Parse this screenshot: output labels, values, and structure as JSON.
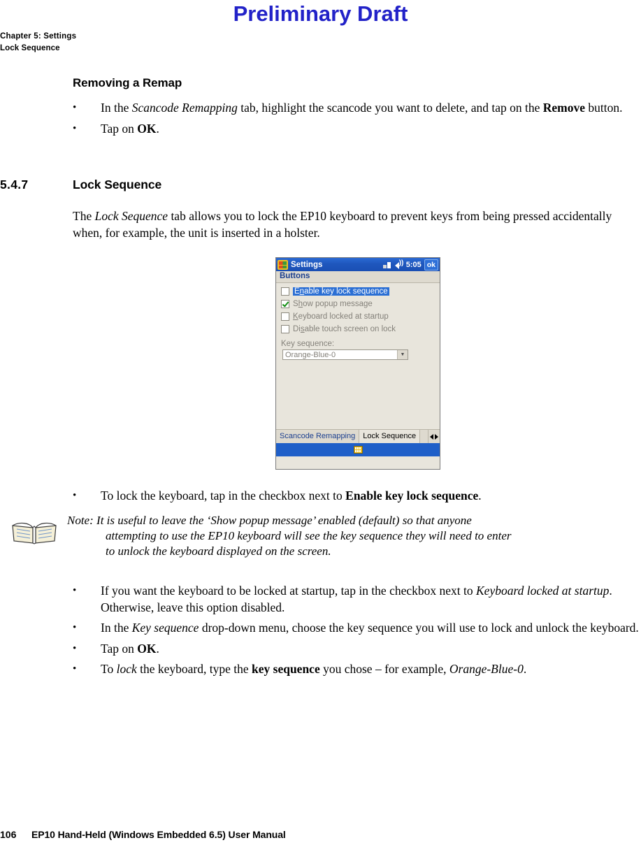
{
  "watermark": "Preliminary Draft",
  "header": {
    "line1": "Chapter 5: Settings",
    "line2": "Lock Sequence"
  },
  "subhead": "Removing a Remap",
  "bullets_top": [
    {
      "mark": "•",
      "parts": [
        {
          "t": "In the ",
          "s": "normal"
        },
        {
          "t": "Scancode Remapping",
          "s": "italic"
        },
        {
          "t": " tab, highlight the scancode you want to delete, and tap on the ",
          "s": "normal"
        },
        {
          "t": "Remove",
          "s": "bold"
        },
        {
          "t": " button.",
          "s": "normal"
        }
      ]
    },
    {
      "mark": "•",
      "parts": [
        {
          "t": "Tap on ",
          "s": "normal"
        },
        {
          "t": "OK",
          "s": "bold"
        },
        {
          "t": ".",
          "s": "normal"
        }
      ]
    }
  ],
  "section": {
    "number": "5.4.7",
    "title": "Lock Sequence"
  },
  "intro_paragraph": [
    {
      "t": "The ",
      "s": "normal"
    },
    {
      "t": "Lock Sequence",
      "s": "italic"
    },
    {
      "t": " tab allows you to lock the EP10 keyboard to prevent keys from being pressed accidentally when, for example, the unit is inserted in a holster.",
      "s": "normal"
    }
  ],
  "device": {
    "title": "Settings",
    "time": "5:05",
    "ok_label": "ok",
    "subbar_label": "Buttons",
    "checkboxes": [
      {
        "label": "Enable key lock sequence",
        "checked": false,
        "state": "selected",
        "underline_index": 1
      },
      {
        "label": "Show popup message",
        "checked": true,
        "state": "dim",
        "underline_index": 1
      },
      {
        "label": "Keyboard locked at startup",
        "checked": false,
        "state": "dim",
        "underline_index": 0
      },
      {
        "label": "Disable touch screen on lock",
        "checked": false,
        "state": "dim",
        "underline_index": 2
      }
    ],
    "key_sequence_label": "Key sequence:",
    "key_sequence_value": "Orange-Blue-0",
    "tabs": [
      {
        "label": "Scancode Remapping",
        "active": false
      },
      {
        "label": "Lock Sequence",
        "active": true
      }
    ],
    "icons": {
      "start": "windows-logo-icon",
      "network": "network-signal-icon",
      "volume": "volume-icon",
      "keyboard": "keyboard-icon",
      "nav_left": "left-arrow-icon",
      "nav_right": "right-arrow-icon",
      "dropdown": "chevron-down-icon"
    }
  },
  "bullet_after_device": {
    "mark": "•",
    "parts": [
      {
        "t": "To lock the keyboard, tap in the checkbox next to ",
        "s": "normal"
      },
      {
        "t": "Enable key lock sequence",
        "s": "bold"
      },
      {
        "t": ".",
        "s": "normal"
      }
    ]
  },
  "note": {
    "label": "Note:",
    "line1": " It is useful to leave the ‘Show popup message’ enabled (default) so that anyone",
    "line2": "attempting to use the EP10 keyboard will see the key sequence they will need to enter",
    "line3": "to unlock the keyboard displayed on the screen.",
    "icon": "note-book-icon"
  },
  "bullets_bottom": [
    {
      "mark": "•",
      "parts": [
        {
          "t": "If you want the keyboard to be locked at startup, tap in the checkbox next to ",
          "s": "normal"
        },
        {
          "t": "Keyboard locked at startup",
          "s": "italic"
        },
        {
          "t": ". Otherwise, leave this option disabled.",
          "s": "normal"
        }
      ]
    },
    {
      "mark": "•",
      "parts": [
        {
          "t": "In the ",
          "s": "normal"
        },
        {
          "t": "Key sequence",
          "s": "italic"
        },
        {
          "t": " drop-down menu, choose the key sequence you will use to lock and unlock the keyboard.",
          "s": "normal"
        }
      ]
    },
    {
      "mark": "•",
      "parts": [
        {
          "t": "Tap on ",
          "s": "normal"
        },
        {
          "t": "OK",
          "s": "bold"
        },
        {
          "t": ".",
          "s": "normal"
        }
      ]
    },
    {
      "mark": "•",
      "parts": [
        {
          "t": "To ",
          "s": "normal"
        },
        {
          "t": "lock",
          "s": "italic"
        },
        {
          "t": " the keyboard, type the ",
          "s": "normal"
        },
        {
          "t": "key sequence",
          "s": "bold"
        },
        {
          "t": " you chose – for example, ",
          "s": "normal"
        },
        {
          "t": "Orange-Blue-0",
          "s": "italic"
        },
        {
          "t": ".",
          "s": "normal"
        }
      ]
    }
  ],
  "footer": {
    "page_number": "106",
    "manual_title": "EP10 Hand-Held (Windows Embedded 6.5) User Manual"
  }
}
